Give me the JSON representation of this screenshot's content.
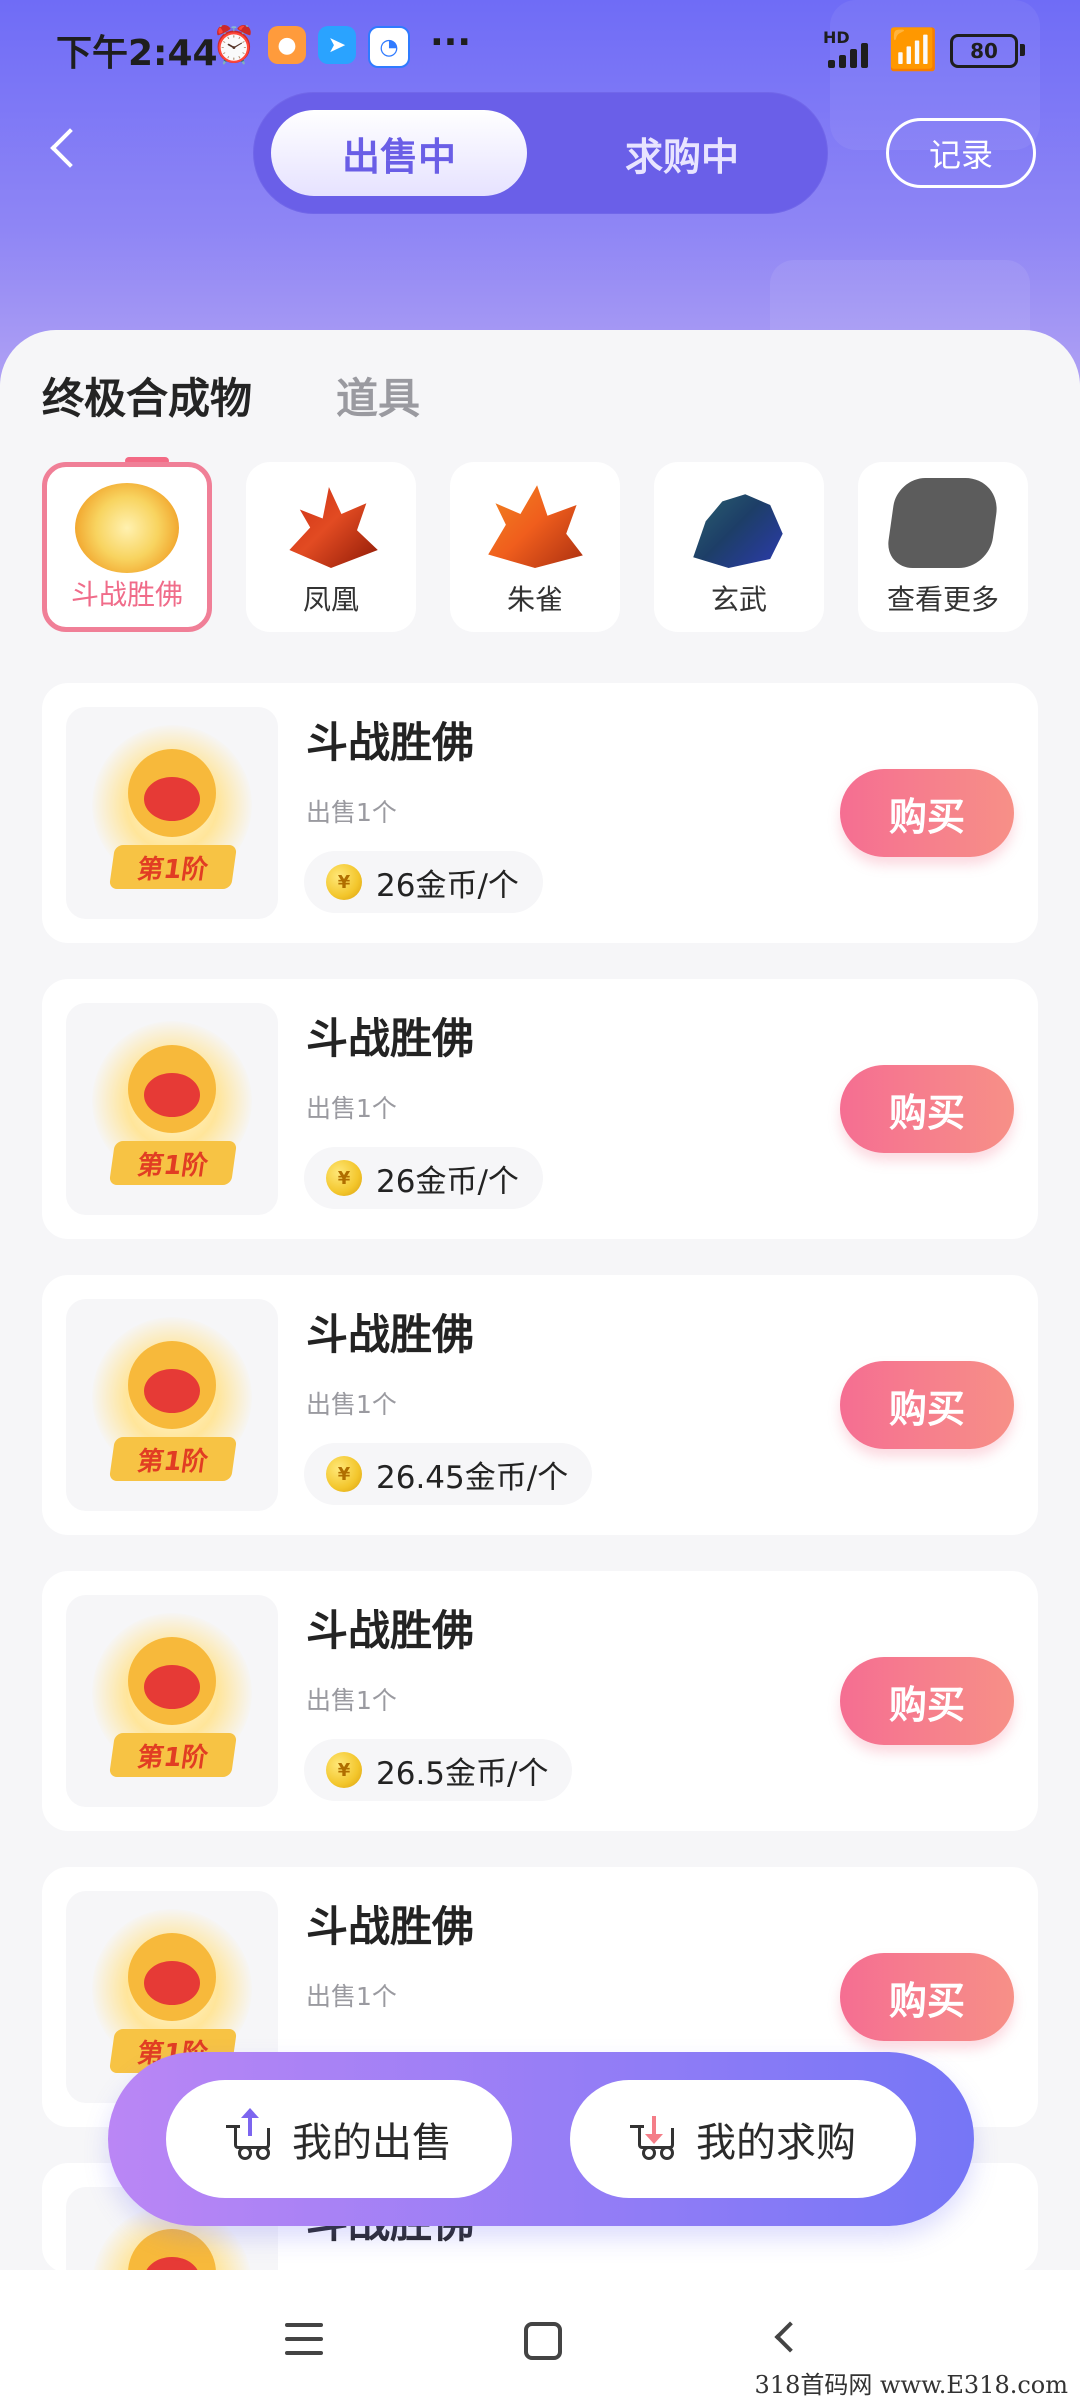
{
  "status_bar": {
    "time": "下午2:44",
    "more": "···",
    "network": "HD",
    "battery": "80",
    "alarm_icon": "alarm-clock-icon",
    "wifi_icon": "wifi-icon"
  },
  "header": {
    "segments": [
      "出售中",
      "求购中"
    ],
    "active_segment": "出售中",
    "record_label": "记录"
  },
  "category_tabs": [
    "终极合成物",
    "道具"
  ],
  "active_category_tab": "终极合成物",
  "chips": [
    {
      "label": "斗战胜佛",
      "active": true
    },
    {
      "label": "凤凰",
      "active": false
    },
    {
      "label": "朱雀",
      "active": false
    },
    {
      "label": "玄武",
      "active": false
    },
    {
      "label": "查看更多",
      "active": false
    }
  ],
  "listings": [
    {
      "name": "斗战胜佛",
      "quantity": "出售1个",
      "price": "26金币/个",
      "badge": "第1阶",
      "buy_label": "购买"
    },
    {
      "name": "斗战胜佛",
      "quantity": "出售1个",
      "price": "26金币/个",
      "badge": "第1阶",
      "buy_label": "购买"
    },
    {
      "name": "斗战胜佛",
      "quantity": "出售1个",
      "price": "26.45金币/个",
      "badge": "第1阶",
      "buy_label": "购买"
    },
    {
      "name": "斗战胜佛",
      "quantity": "出售1个",
      "price": "26.5金币/个",
      "badge": "第1阶",
      "buy_label": "购买"
    },
    {
      "name": "斗战胜佛",
      "quantity": "出售1个",
      "price": "",
      "badge": "第1阶",
      "buy_label": "购买"
    },
    {
      "name": "斗战胜佛",
      "quantity": "",
      "price": "",
      "badge": "",
      "buy_label": ""
    }
  ],
  "bottom_actions": {
    "my_sales": "我的出售",
    "my_purchases": "我的求购"
  },
  "coin_symbol": "¥",
  "watermark": "318首码网 www.E318.com",
  "colors": {
    "header_gradient_top": "#6f6cf6",
    "accent_pink": "#f36a85",
    "buy_button": "#f56e92",
    "float_bar_left": "#ba86f5",
    "float_bar_right": "#7676f6"
  }
}
